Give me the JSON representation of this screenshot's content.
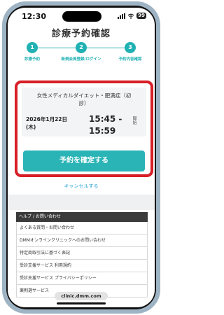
{
  "status_bar": {
    "time": "12:30",
    "battery": "99"
  },
  "page": {
    "title": "診療予約確認"
  },
  "steps": [
    {
      "number": "1",
      "label": "診療予約"
    },
    {
      "number": "2",
      "label": "新規会員登録/ログイン"
    },
    {
      "number": "3",
      "label": "予約内容確認"
    }
  ],
  "reservation": {
    "menu_line1": "女性メディカルダイエット・肥満症（初",
    "menu_line2": "診）",
    "date_line1": "2026年1月22日",
    "date_line2": "(木)",
    "time_start": "15:45 -",
    "time_end": "15:59",
    "open_label": "開始"
  },
  "actions": {
    "confirm": "予約を確定する",
    "cancel": "キャンセルする"
  },
  "help": {
    "header": "ヘルプ / お問い合わせ",
    "items": [
      "よくある質問・お問い合わせ",
      "DMMオンラインクリニックへのお問い合わせ",
      "特定商取引法に基づく表記",
      "受診支援サービス 利用規約",
      "受診支援サービス プライバシーポリシー",
      "薬剤選サービス"
    ]
  },
  "browser": {
    "url": "clinic.dmm.com"
  },
  "colors": {
    "accent": "#20b1b3",
    "highlight": "#d71f27",
    "link": "#2aa5d6"
  }
}
